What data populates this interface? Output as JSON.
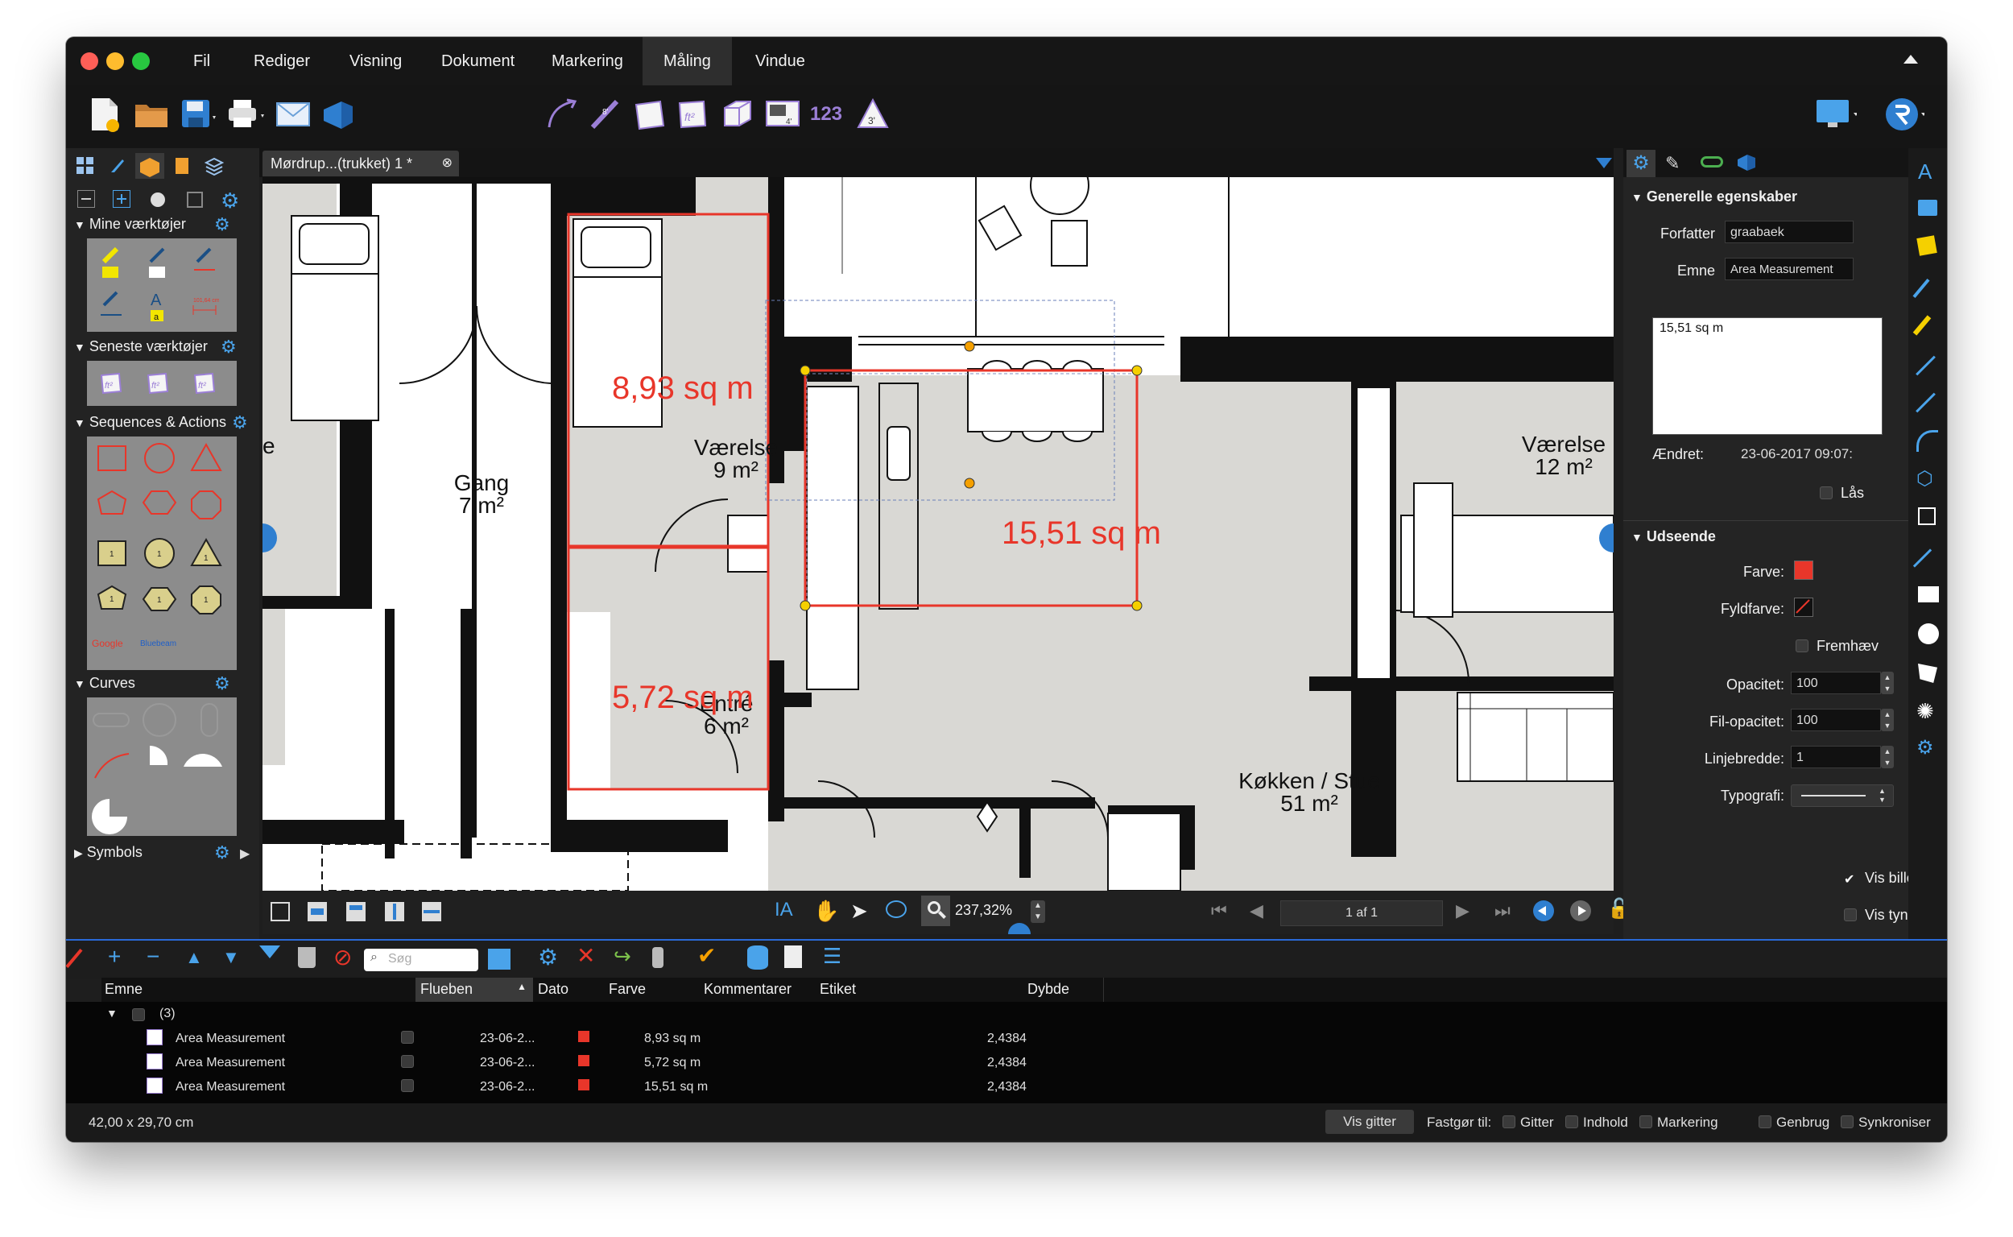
{
  "menubar": {
    "items": [
      "Fil",
      "Rediger",
      "Visning",
      "Dokument",
      "Markering",
      "Måling",
      "Vindue"
    ],
    "active": "Måling"
  },
  "toolbar": {
    "measure_count_label": "123"
  },
  "left_panel": {
    "sections": {
      "my_tools": "Mine værktøjer",
      "recent_tools": "Seneste værktøjer",
      "sequences": "Sequences & Actions",
      "curves": "Curves",
      "symbols": "Symbols"
    },
    "seq_text1": "Google",
    "seq_text2": "Bluebeam"
  },
  "document": {
    "tab_title": "Mørdrup...(trukket) 1 *"
  },
  "floorplan": {
    "rooms": [
      {
        "name": "Gang",
        "area": "7 m²"
      },
      {
        "name": "Værelse",
        "area": "9 m²"
      },
      {
        "name": "Entré",
        "area": "6 m²"
      },
      {
        "name": "Værelse",
        "area": "12 m²"
      },
      {
        "name": "Køkken / Stue",
        "area": "51 m²"
      }
    ],
    "measurements": [
      "8,93 sq m",
      "5,72 sq m",
      "15,51 sq m"
    ],
    "partial_label": "e"
  },
  "canvas_bar": {
    "zoom": "237,32%",
    "page": "1 af 1"
  },
  "properties": {
    "general_header": "Generelle egenskaber",
    "author_label": "Forfatter",
    "author_value": "graabaek",
    "subject_label": "Emne",
    "subject_value": "Area Measurement",
    "comment_value": "15,51 sq m",
    "modified_label": "Ændret:",
    "modified_value": "23-06-2017 09:07:",
    "lock_label": "Lås",
    "appearance_header": "Udseende",
    "color_label": "Farve:",
    "color": "#e8362a",
    "fill_label": "Fyldfarve:",
    "highlight_label": "Fremhæv",
    "opacity_label": "Opacitet:",
    "opacity_value": "100",
    "fill_opacity_label": "Fil-opacitet:",
    "fill_opacity_value": "100",
    "line_width_label": "Linjebredde:",
    "line_width_value": "1",
    "typography_label": "Typografi:",
    "show_image_label": "Vis billedte",
    "show_weight_label": "Vis tyngdepı"
  },
  "markups_list": {
    "search_placeholder": "Søg",
    "columns": [
      "Emne",
      "Flueben",
      "Dato",
      "Farve",
      "Kommentarer",
      "Etiket",
      "Dybde"
    ],
    "group_label": "(3)",
    "rows": [
      {
        "subject": "Area Measurement",
        "date": "23-06-2...",
        "comment": "8,93 sq m",
        "depth": "2,4384"
      },
      {
        "subject": "Area Measurement",
        "date": "23-06-2...",
        "comment": "5,72 sq m",
        "depth": "2,4384"
      },
      {
        "subject": "Area Measurement",
        "date": "23-06-2...",
        "comment": "15,51 sq m",
        "depth": "2,4384"
      }
    ]
  },
  "statusbar": {
    "paper_size": "42,00 x 29,70 cm",
    "grid_button": "Vis gitter",
    "snap_label": "Fastgør til:",
    "snap_grid": "Gitter",
    "snap_content": "Indhold",
    "snap_markup": "Markering",
    "reuse": "Genbrug",
    "sync": "Synkroniser"
  }
}
